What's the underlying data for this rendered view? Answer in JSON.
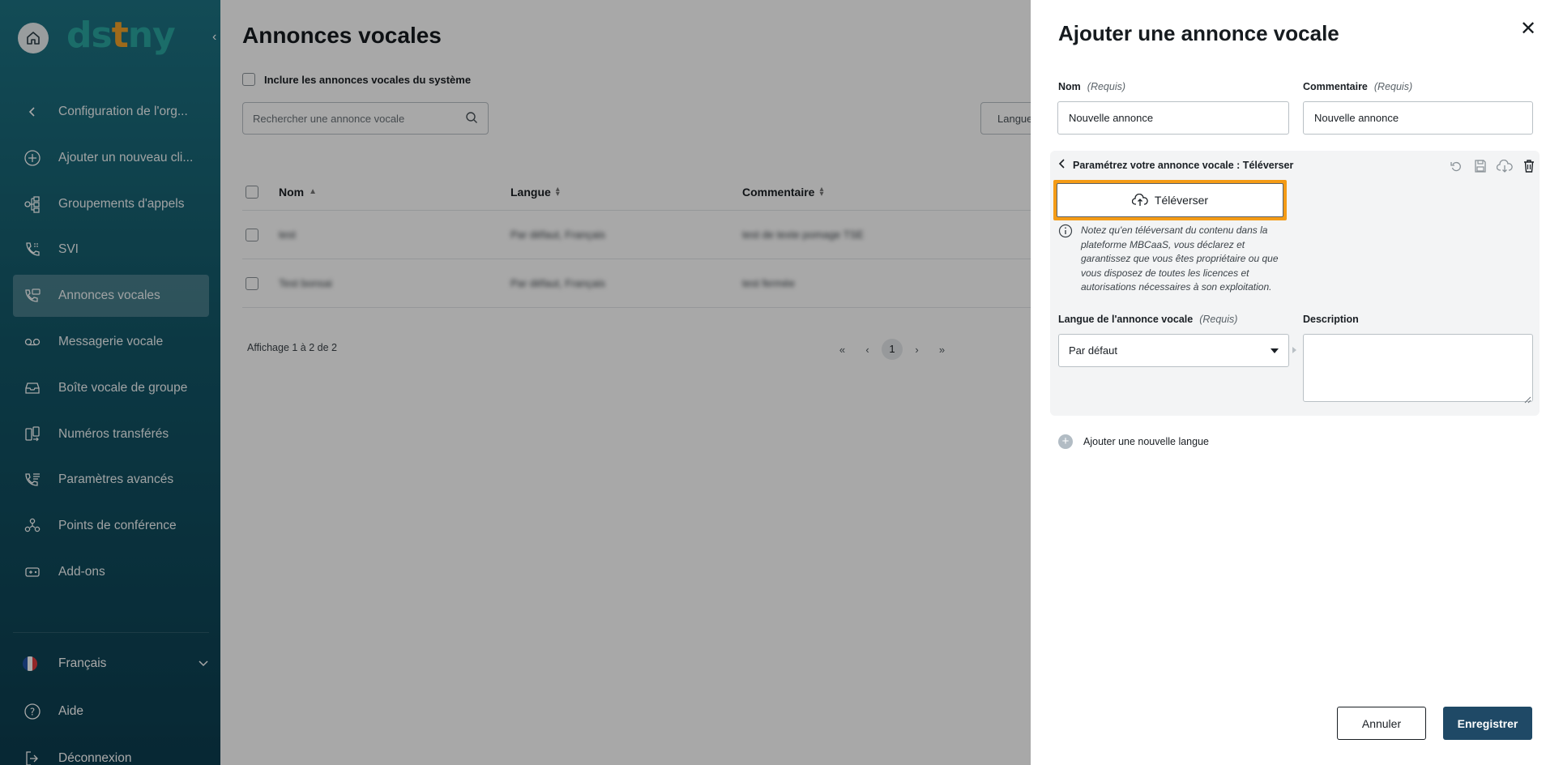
{
  "sidebar": {
    "logo": "dstny",
    "items": [
      {
        "label": "Configuration de l'org...",
        "icon": "chevron-left-icon"
      },
      {
        "label": "Ajouter un nouveau cli...",
        "icon": "plus-circle-icon"
      },
      {
        "label": "Groupements d'appels",
        "icon": "call-group-icon"
      },
      {
        "label": "SVI",
        "icon": "ivr-phone-icon"
      },
      {
        "label": "Annonces vocales",
        "icon": "voice-announcement-icon",
        "active": true
      },
      {
        "label": "Messagerie vocale",
        "icon": "voicemail-icon"
      },
      {
        "label": "Boîte vocale de groupe",
        "icon": "inbox-icon"
      },
      {
        "label": "Numéros transférés",
        "icon": "forwarded-number-icon"
      },
      {
        "label": "Paramètres avancés",
        "icon": "advanced-settings-icon"
      },
      {
        "label": "Points de conférence",
        "icon": "conference-icon"
      },
      {
        "label": "Add-ons",
        "icon": "addons-icon"
      }
    ],
    "language": "Français",
    "help": "Aide",
    "logout": "Déconnexion"
  },
  "main": {
    "title": "Annonces vocales",
    "include_system_label": "Inclure les annonces vocales du système",
    "search_placeholder": "Rechercher une annonce vocale",
    "language_filter": "Langue",
    "columns": {
      "name": "Nom",
      "language": "Langue",
      "comment": "Commentaire"
    },
    "rows": [
      {
        "name": "test",
        "language": "Par défaut, Français",
        "comment": "test de texte pomage TSE"
      },
      {
        "name": "Test bonsai",
        "language": "Par défaut, Français",
        "comment": "test fermée"
      }
    ],
    "showing": "Affichage 1 à 2 de 2",
    "pagination": {
      "first": "«",
      "prev": "‹",
      "current": "1",
      "next": "›",
      "last": "»"
    }
  },
  "drawer": {
    "title": "Ajouter une annonce vocale",
    "close": "✕",
    "name_label": "Nom",
    "name_required": "(Requis)",
    "name_value": "Nouvelle annonce",
    "comment_label": "Commentaire",
    "comment_required": "(Requis)",
    "comment_value": "Nouvelle annonce",
    "config_title": "Paramétrez votre annonce vocale : Téléverser",
    "upload_label": "Téléverser",
    "notice": "Notez qu'en téléversant du contenu dans la plateforme MBCaaS, vous déclarez et garantissez que vous êtes propriétaire ou que vous disposez de toutes les licences et autorisations nécessaires à son exploitation.",
    "lang_label": "Langue de l'annonce vocale",
    "lang_required": "(Requis)",
    "lang_value": "Par défaut",
    "description_label": "Description",
    "add_language": "Ajouter une nouvelle langue",
    "cancel": "Annuler",
    "save": "Enregistrer"
  },
  "colors": {
    "sidebar_top": "#1d7383",
    "sidebar_bottom": "#0c3d4f",
    "highlight": "#f49b16",
    "primary_button": "#1f4966"
  }
}
